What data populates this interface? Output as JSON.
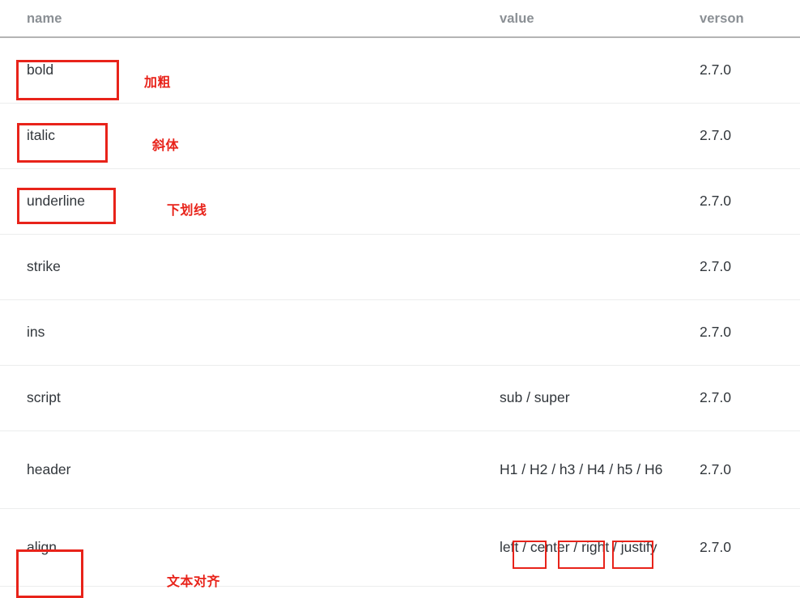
{
  "table": {
    "columns": [
      {
        "key": "name",
        "label": "name"
      },
      {
        "key": "value",
        "label": "value"
      },
      {
        "key": "version",
        "label": "verson"
      }
    ],
    "rows": [
      {
        "name": "bold",
        "value": "",
        "version": "2.7.0"
      },
      {
        "name": "italic",
        "value": "",
        "version": "2.7.0"
      },
      {
        "name": "underline",
        "value": "",
        "version": "2.7.0"
      },
      {
        "name": "strike",
        "value": "",
        "version": "2.7.0"
      },
      {
        "name": "ins",
        "value": "",
        "version": "2.7.0"
      },
      {
        "name": "script",
        "value": "sub / super",
        "version": "2.7.0"
      },
      {
        "name": "header",
        "value": "H1 / H2 / h3 / H4 / h5 / H6",
        "version": "2.7.0"
      },
      {
        "name": "align",
        "value": "left / center / right / justify",
        "version": "2.7.0"
      }
    ]
  },
  "annotations": {
    "accent_color": "#e8231a",
    "labels": [
      {
        "id": "bold",
        "text": "加粗"
      },
      {
        "id": "italic",
        "text": "斜体"
      },
      {
        "id": "underline",
        "text": "下划线"
      },
      {
        "id": "align",
        "text": "文本对齐"
      }
    ],
    "highlight_boxes": [
      {
        "id": "bold-cell"
      },
      {
        "id": "italic-cell"
      },
      {
        "id": "underline-cell"
      },
      {
        "id": "align-cell"
      },
      {
        "id": "align-value-left"
      },
      {
        "id": "align-value-center"
      },
      {
        "id": "align-value-right"
      }
    ]
  }
}
